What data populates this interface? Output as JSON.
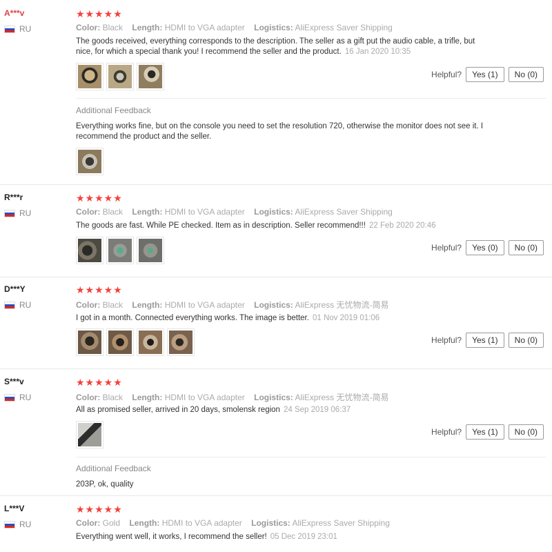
{
  "labels": {
    "color": "Color:",
    "length": "Length:",
    "logistics": "Logistics:",
    "helpful": "Helpful?",
    "additional_feedback": "Additional Feedback"
  },
  "reviews": [
    {
      "user": "A***v",
      "country": "RU",
      "stars": "★★★★★",
      "color": "Black",
      "length": "HDMI to VGA adapter",
      "logistics": "AliExpress Saver Shipping",
      "text": "The goods received, everything corresponds to the description. The seller as a gift put the audio cable, a trifle, but nice, for which a special thank you! I recommend the seller and the product.",
      "date": "16 Jan 2020 10:35",
      "yes": "Yes (1)",
      "no": "No (0)",
      "additional": "Everything works fine, but on the console you need to set the resolution 720, otherwise the monitor does not see it. I recommend the product and the seller."
    },
    {
      "user": "R***r",
      "country": "RU",
      "stars": "★★★★★",
      "color": "Black",
      "length": "HDMI to VGA adapter",
      "logistics": "AliExpress Saver Shipping",
      "text": "The goods are fast. While PE checked. Item as in description. Seller recommend!!!",
      "date": "22 Feb 2020 20:46",
      "yes": "Yes (0)",
      "no": "No (0)"
    },
    {
      "user": "D***Y",
      "country": "RU",
      "stars": "★★★★★",
      "color": "Black",
      "length": "HDMI to VGA adapter",
      "logistics": "AliExpress 无忧物流-简易",
      "text": "I got in a month. Connected everything works. The image is better.",
      "date": "01 Nov 2019 01:06",
      "yes": "Yes (1)",
      "no": "No (0)"
    },
    {
      "user": "S***v",
      "country": "RU",
      "stars": "★★★★★",
      "color": "Black",
      "length": "HDMI to VGA adapter",
      "logistics": "AliExpress 无忧物流-简易",
      "text": "All as promised seller, arrived in 20 days, smolensk region",
      "date": "24 Sep 2019 06:37",
      "yes": "Yes (1)",
      "no": "No (0)",
      "additional": "203P, ok, quality"
    },
    {
      "user": "L***V",
      "country": "RU",
      "stars": "★★★★★",
      "color": "Gold",
      "length": "HDMI to VGA adapter",
      "logistics": "AliExpress Saver Shipping",
      "text": "Everything went well, it works, I recommend the seller!",
      "date": "05 Dec 2019 23:01"
    }
  ]
}
